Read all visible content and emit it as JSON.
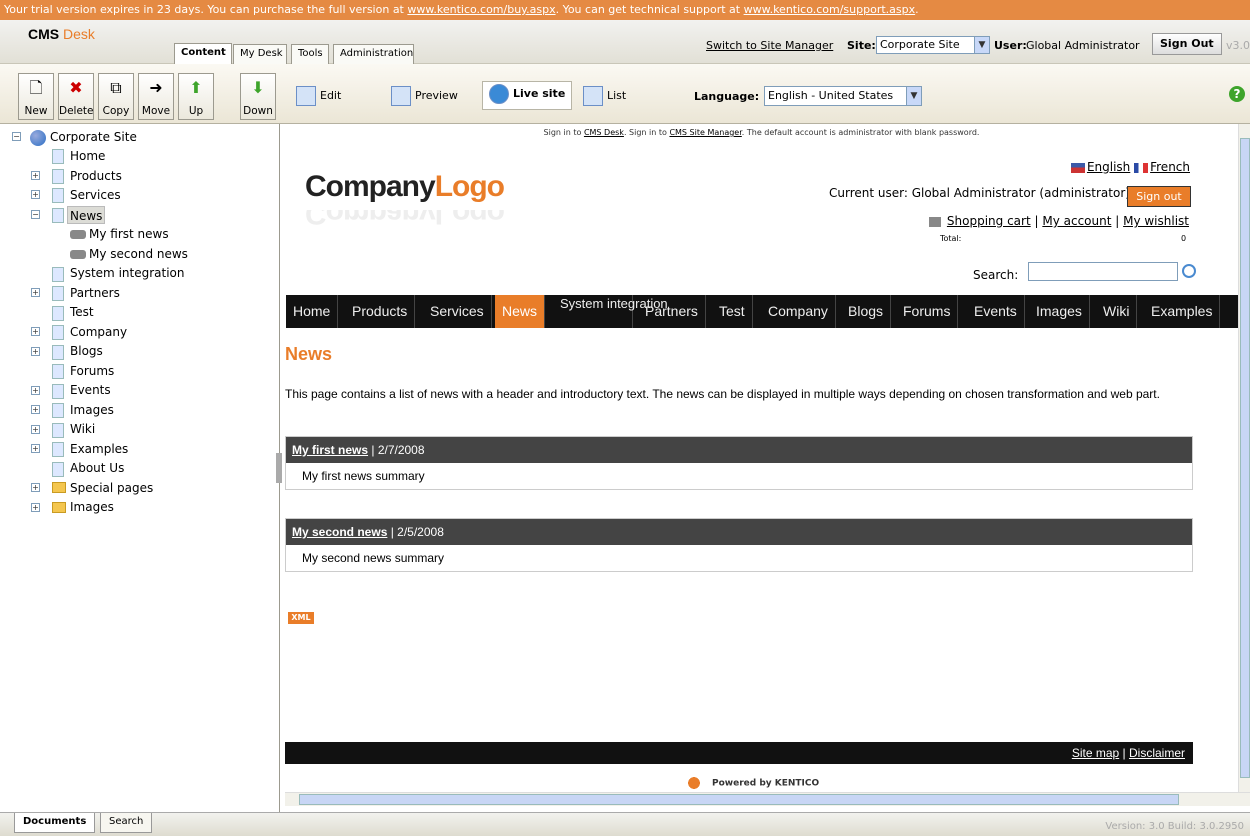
{
  "trial_bar": {
    "prefix": "Your trial version expires in 23 days. You can purchase the full version at ",
    "buy_link": "www.kentico.com/buy.aspx",
    "middle": ". You can get technical support at ",
    "support_link": "www.kentico.com/support.aspx",
    "suffix": "."
  },
  "header": {
    "brand_cms": "CMS",
    "brand_desk": "Desk",
    "tabs": [
      "Content",
      "My Desk",
      "Tools",
      "Administration"
    ],
    "switch_link": "Switch to Site Manager",
    "site_label": "Site:",
    "site_value": "Corporate Site",
    "user_label": "User:",
    "user_value": "Global Administrator",
    "signout": "Sign Out",
    "version": "v3.0"
  },
  "toolbar": {
    "buttons": [
      "New",
      "Delete",
      "Copy",
      "Move",
      "Up",
      "Down"
    ],
    "views": [
      "Edit",
      "Preview",
      "Live site",
      "List"
    ],
    "language_label": "Language:",
    "language_value": "English - United States"
  },
  "tree": {
    "root": "Corporate Site",
    "items": [
      "Home",
      "Products",
      "Services",
      "News",
      "My first news",
      "My second news",
      "System integration",
      "Partners",
      "Test",
      "Company",
      "Blogs",
      "Forums",
      "Events",
      "Images",
      "Wiki",
      "Examples",
      "About Us",
      "Special pages",
      "Images"
    ]
  },
  "page": {
    "notice_a": "Sign in to ",
    "notice_link1": "CMS Desk",
    "notice_b": ". Sign in to ",
    "notice_link2": "CMS Site Manager",
    "notice_c": ". The default account is administrator with blank password.",
    "logo_company": "Company",
    "logo_logo": "Logo",
    "lang_english": "English",
    "lang_french": "French",
    "current_user": "Current user:  Global Administrator (administrator)",
    "signout": "Sign out",
    "shopping_cart": "Shopping cart",
    "my_account": "My account",
    "my_wishlist": "My wishlist",
    "separator": " | ",
    "total_label": "Total:",
    "total_value": "0",
    "search_label": "Search:",
    "nav": [
      "Home",
      "Products",
      "Services",
      "News",
      "System integration",
      "Partners",
      "Test",
      "Company",
      "Blogs",
      "Forums",
      "Events",
      "Images",
      "Wiki",
      "Examples"
    ],
    "title": "News",
    "intro": "This page contains a list of news with a header and introductory text. The news can be displayed in multiple ways depending on chosen transformation and web part.",
    "news": [
      {
        "title": "My first news",
        "date": " | 2/7/2008",
        "summary": "My first news summary"
      },
      {
        "title": "My second news",
        "date": " | 2/5/2008",
        "summary": "My second news summary"
      }
    ],
    "xml_badge": "XML",
    "footer_sitemap": "Site map",
    "footer_sep": " | ",
    "footer_disclaimer": "Disclaimer",
    "powered": "Powered by KENTICO"
  },
  "bottom": {
    "tabs": [
      "Documents",
      "Search"
    ],
    "version": "Version: 3.0 Build: 3.0.2950"
  },
  "colors": {
    "accent": "#e97d29",
    "trial_bar": "#e58a43",
    "nav_bg": "#111111"
  }
}
